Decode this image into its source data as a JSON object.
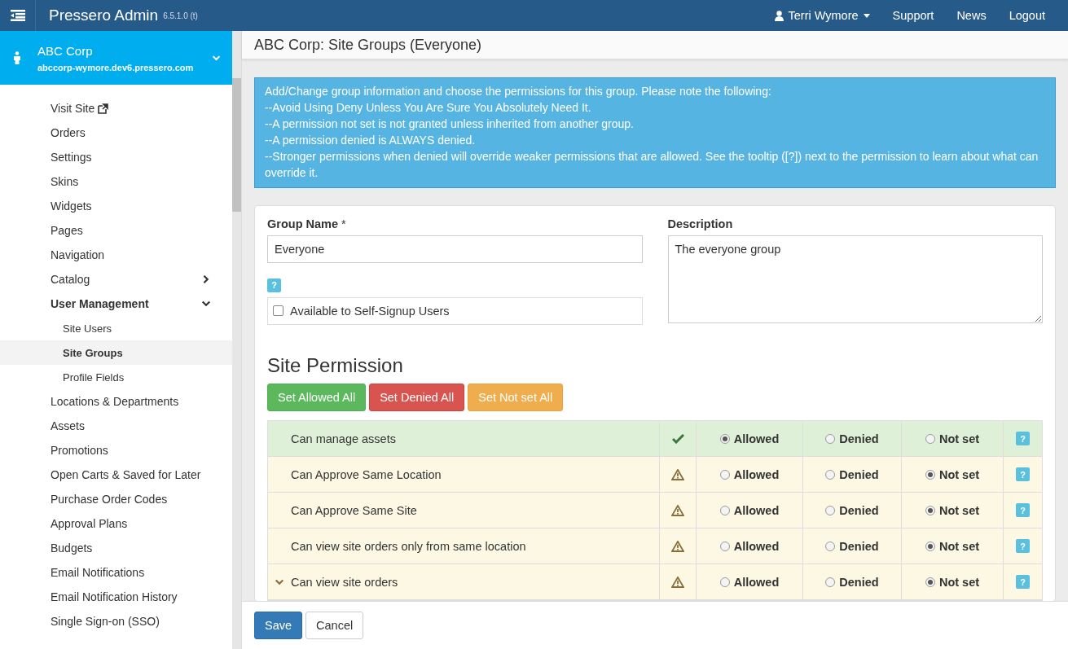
{
  "header": {
    "app_name": "Pressero Admin",
    "version": "6.5.1.0 (t)",
    "user": "Terri Wymore",
    "links": [
      "Support",
      "News",
      "Logout"
    ]
  },
  "account": {
    "name": "ABC Corp",
    "domain": "abccorp-wymore.dev6.pressero.com"
  },
  "sidebar": {
    "items": [
      {
        "label": "Visit Site",
        "kind": "external",
        "selected": false
      },
      {
        "label": "Orders",
        "kind": "link",
        "selected": false
      },
      {
        "label": "Settings",
        "kind": "link",
        "selected": false
      },
      {
        "label": "Skins",
        "kind": "link",
        "selected": false
      },
      {
        "label": "Widgets",
        "kind": "link",
        "selected": false
      },
      {
        "label": "Pages",
        "kind": "link",
        "selected": false
      },
      {
        "label": "Navigation",
        "kind": "link",
        "selected": false
      },
      {
        "label": "Catalog",
        "kind": "group",
        "selected": false,
        "expanded": false
      },
      {
        "label": "User Management",
        "kind": "group",
        "selected": false,
        "expanded": true,
        "children": [
          {
            "label": "Site Users",
            "selected": false
          },
          {
            "label": "Site Groups",
            "selected": true
          },
          {
            "label": "Profile Fields",
            "selected": false
          }
        ]
      },
      {
        "label": "Locations & Departments",
        "kind": "link",
        "selected": false
      },
      {
        "label": "Assets",
        "kind": "link",
        "selected": false
      },
      {
        "label": "Promotions",
        "kind": "link",
        "selected": false
      },
      {
        "label": "Open Carts & Saved for Later",
        "kind": "link",
        "selected": false
      },
      {
        "label": "Purchase Order Codes",
        "kind": "link",
        "selected": false
      },
      {
        "label": "Approval Plans",
        "kind": "link",
        "selected": false
      },
      {
        "label": "Budgets",
        "kind": "link",
        "selected": false
      },
      {
        "label": "Email Notifications",
        "kind": "link",
        "selected": false
      },
      {
        "label": "Email Notification History",
        "kind": "link",
        "selected": false
      },
      {
        "label": "Single Sign-on (SSO)",
        "kind": "link",
        "selected": false
      }
    ]
  },
  "page_title": "ABC Corp: Site Groups (Everyone)",
  "info_lines": [
    "Add/Change group information and choose the permissions for this group. Please note the following:",
    "--Avoid Using Deny Unless You Are Sure You Absolutely Need It.",
    "--A permission not set is not granted unless inherited from another group.",
    "--A permission denied is ALWAYS denied.",
    "--Stronger permissions when denied will override weaker permissions that are allowed. See the tooltip ([?]) next to the permission to learn about what can override it."
  ],
  "form": {
    "group_name_label": "Group Name",
    "required_mark": "*",
    "group_name": "Everyone",
    "help_badge": "?",
    "self_signup": {
      "label": "Available to Self-Signup Users",
      "checked": false
    },
    "description_label": "Description",
    "description": "The everyone group"
  },
  "permissions": {
    "title": "Site Permission",
    "buttons": [
      {
        "label": "Set Allowed All",
        "kind": "success"
      },
      {
        "label": "Set Denied All",
        "kind": "danger"
      },
      {
        "label": "Set Not set All",
        "kind": "warning"
      }
    ],
    "rows": [
      {
        "name": "Can manage assets",
        "kind": "allowed",
        "help": "?",
        "options": [
          {
            "label": "Allowed",
            "selected": true
          },
          {
            "label": "Denied",
            "selected": false
          },
          {
            "label": "Not set",
            "selected": false
          }
        ]
      },
      {
        "name": "Can Approve Same Location",
        "kind": "warning",
        "help": "?",
        "options": [
          {
            "label": "Allowed",
            "selected": false
          },
          {
            "label": "Denied",
            "selected": false
          },
          {
            "label": "Not set",
            "selected": true
          }
        ]
      },
      {
        "name": "Can Approve Same Site",
        "kind": "warning",
        "help": "?",
        "options": [
          {
            "label": "Allowed",
            "selected": false
          },
          {
            "label": "Denied",
            "selected": false
          },
          {
            "label": "Not set",
            "selected": true
          }
        ]
      },
      {
        "name": "Can view site orders only from same location",
        "kind": "warning",
        "help": "?",
        "options": [
          {
            "label": "Allowed",
            "selected": false
          },
          {
            "label": "Denied",
            "selected": false
          },
          {
            "label": "Not set",
            "selected": true
          }
        ]
      },
      {
        "name": "Can view site orders",
        "kind": "warning",
        "expanded": true,
        "help": "?",
        "options": [
          {
            "label": "Allowed",
            "selected": false
          },
          {
            "label": "Denied",
            "selected": false
          },
          {
            "label": "Not set",
            "selected": true
          }
        ]
      }
    ]
  },
  "footer": {
    "buttons": [
      {
        "label": "Save",
        "kind": "primary"
      },
      {
        "label": "Cancel",
        "kind": "default"
      }
    ]
  }
}
